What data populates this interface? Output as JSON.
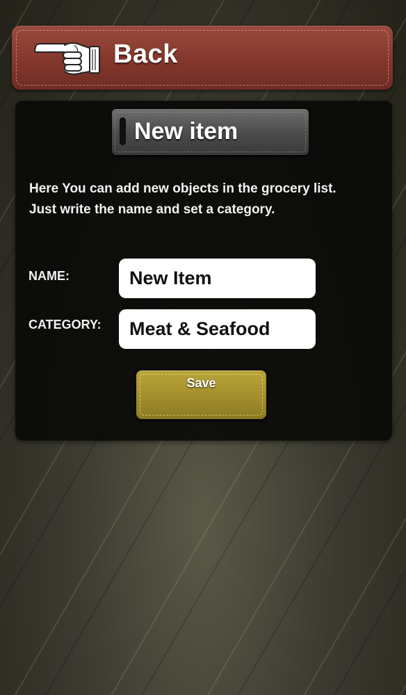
{
  "back_bar": {
    "icon": "pointing-hand-left-icon",
    "label": "Back",
    "color": "#84372c"
  },
  "panel": {
    "title": "New item",
    "description_line1": "Here You can add new objects in the grocery list.",
    "description_line2": "Just write the name and set a category."
  },
  "form": {
    "name_label": "NAME:",
    "name_value": "New Item",
    "category_label": "CATEGORY:",
    "category_value": "Meat & Seafood"
  },
  "save_button": {
    "label": "Save",
    "color": "#a38e2c"
  }
}
